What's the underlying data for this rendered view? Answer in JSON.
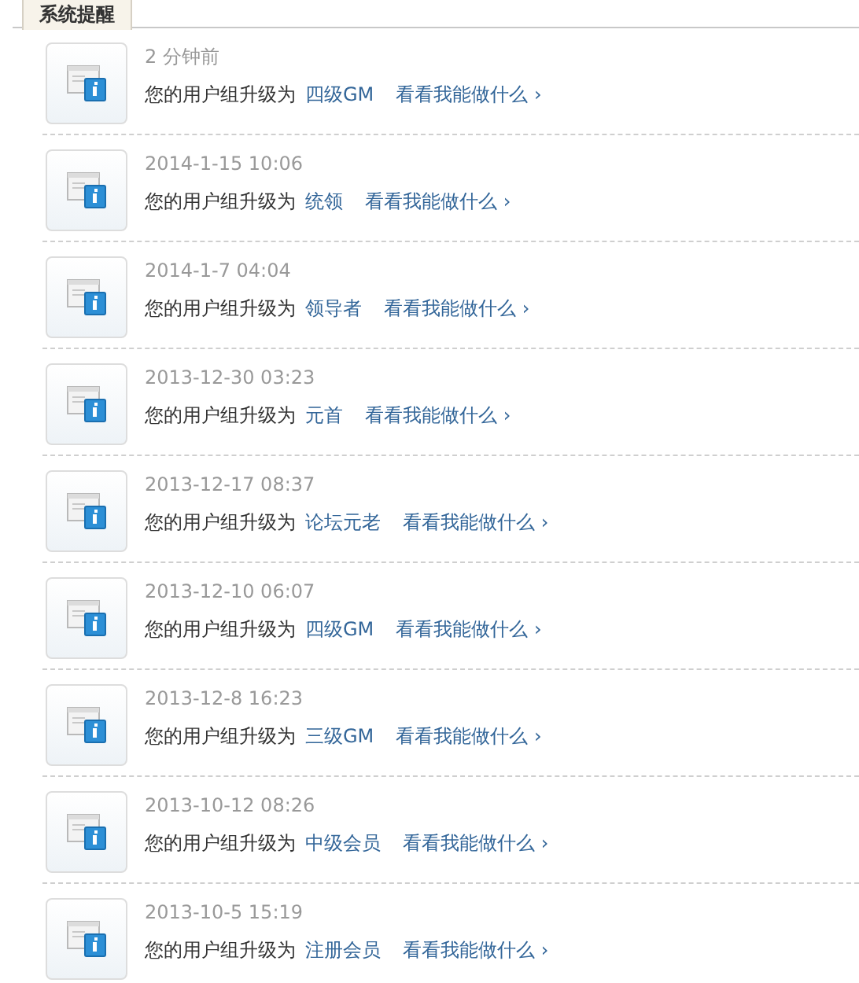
{
  "tab": {
    "label": "系统提醒",
    "selected": true
  },
  "notices": [
    {
      "time": "2 分钟前",
      "message": "您的用户组升级为",
      "group": "四级GM",
      "link": "看看我能做什么 ›"
    },
    {
      "time": "2014-1-15 10:06",
      "message": "您的用户组升级为",
      "group": "统领",
      "link": "看看我能做什么 ›"
    },
    {
      "time": "2014-1-7 04:04",
      "message": "您的用户组升级为",
      "group": "领导者",
      "link": "看看我能做什么 ›"
    },
    {
      "time": "2013-12-30 03:23",
      "message": "您的用户组升级为",
      "group": "元首",
      "link": "看看我能做什么 ›"
    },
    {
      "time": "2013-12-17 08:37",
      "message": "您的用户组升级为",
      "group": "论坛元老",
      "link": "看看我能做什么 ›"
    },
    {
      "time": "2013-12-10 06:07",
      "message": "您的用户组升级为",
      "group": "四级GM",
      "link": "看看我能做什么 ›"
    },
    {
      "time": "2013-12-8 16:23",
      "message": "您的用户组升级为",
      "group": "三级GM",
      "link": "看看我能做什么 ›"
    },
    {
      "time": "2013-10-12 08:26",
      "message": "您的用户组升级为",
      "group": "中级会员",
      "link": "看看我能做什么 ›"
    },
    {
      "time": "2013-10-5 15:19",
      "message": "您的用户组升级为",
      "group": "注册会员",
      "link": "看看我能做什么 ›"
    }
  ]
}
